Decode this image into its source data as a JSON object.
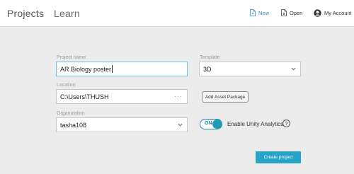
{
  "header": {
    "tabs": [
      {
        "label": "Projects"
      },
      {
        "label": "Learn"
      }
    ],
    "actions": {
      "new_label": "New",
      "open_label": "Open",
      "account_label": "My Account"
    },
    "accent_color": "#2d8ec9"
  },
  "form": {
    "project_name": {
      "label": "Project name",
      "value": "AR Biology poster"
    },
    "template": {
      "label": "Template",
      "value": "3D"
    },
    "location": {
      "label": "Location",
      "value": "C:\\Users\\THUSH",
      "browse": "···"
    },
    "asset_package_button": "Add Asset Package",
    "organization": {
      "label": "Organization",
      "value": "tasha108"
    },
    "analytics": {
      "toggle_state": "ON",
      "label": "Enable Unity Analytics",
      "help": "?"
    },
    "create_button": "Create project"
  },
  "icons": [
    "new-file-icon",
    "open-file-icon",
    "account-avatar-icon",
    "chevron-down-icon",
    "help-icon"
  ]
}
